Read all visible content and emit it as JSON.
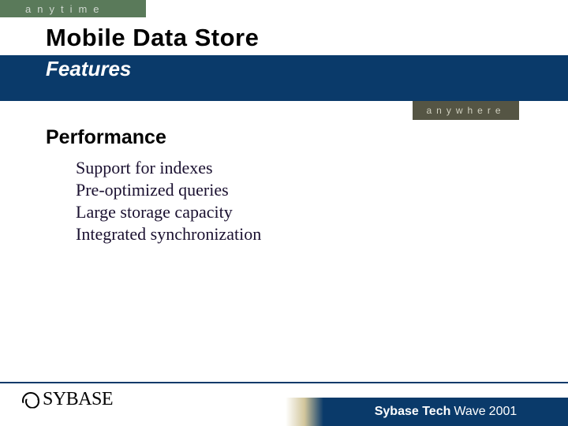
{
  "header": {
    "top_badge": "anytime",
    "title": "Mobile Data Store",
    "subtitle": "Features",
    "anywhere_badge": "anywhere"
  },
  "content": {
    "section_heading": "Performance",
    "bullets": [
      "Support for indexes",
      "Pre-optimized queries",
      "Large storage capacity",
      "Integrated synchronization"
    ]
  },
  "footer": {
    "logo_text": "SYBASE",
    "event_bold": "Sybase Tech",
    "event_light": "Wave",
    "event_year": " 2001"
  }
}
